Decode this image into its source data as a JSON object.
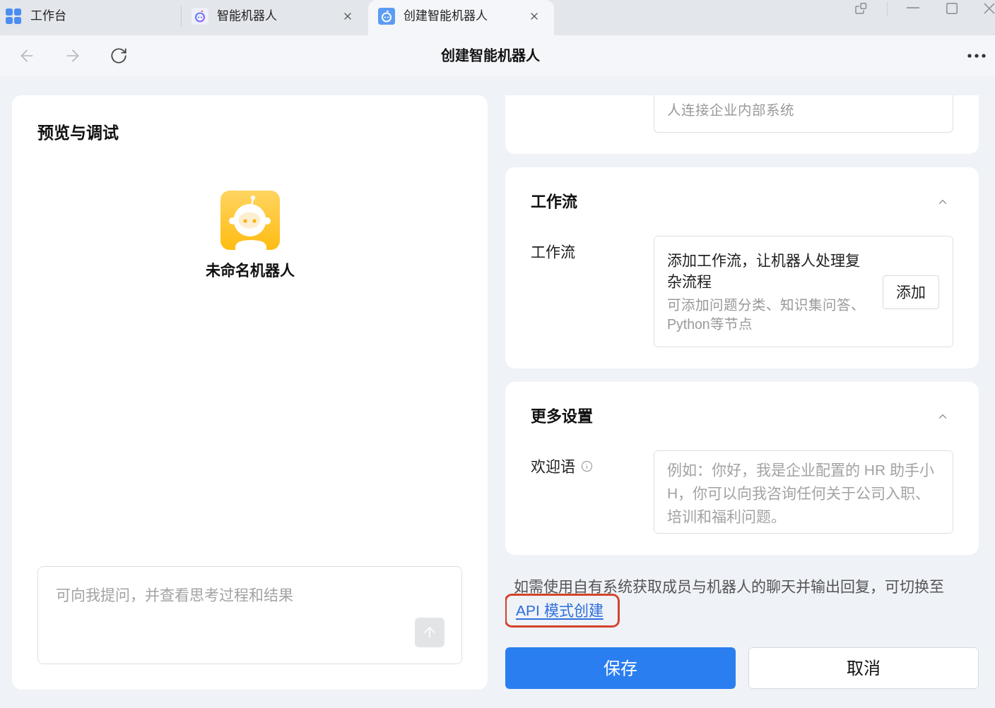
{
  "tabs": [
    {
      "label": "工作台",
      "kind": "home",
      "selected": false,
      "closable": false
    },
    {
      "label": "智能机器人",
      "kind": "bot",
      "selected": false,
      "closable": true
    },
    {
      "label": "创建智能机器人",
      "kind": "bot-editor",
      "selected": true,
      "closable": true
    }
  ],
  "nav": {
    "buttons": [
      {
        "kind": "back",
        "disabled": true
      },
      {
        "kind": "forward",
        "disabled": true
      },
      {
        "kind": "refresh",
        "disabled": false
      }
    ],
    "title": "创建智能机器人"
  },
  "preview": {
    "title": "预览与调试",
    "bot_name": "未命名机器人",
    "chat_input": {
      "placeholder": "可向我提问，并查看思考过程和结果"
    },
    "send_disabled": true
  },
  "plugin_card": {
    "description": "人连接企业内部系统"
  },
  "sections": [
    {
      "kind": "workflow",
      "title": "工作流",
      "expanded": true,
      "label": "工作流",
      "headline": "添加工作流，让机器人处理复杂流程",
      "description": "可添加问题分类、知识集问答、Python等节点",
      "button": "添加"
    },
    {
      "kind": "welcome",
      "title": "更多设置",
      "expanded": true,
      "label": "欢迎语",
      "placeholder": "例如：你好，我是企业配置的 HR 助手小H，你可以向我咨询任何关于公司入职、培训和福利问题。"
    }
  ],
  "api_note": {
    "text": "如需使用自有系统获取成员与机器人的聊天并输出回复，可切换至",
    "link": "API 模式创建",
    "highlighted": true
  },
  "actions": [
    {
      "label": "保存",
      "kind": "primary"
    },
    {
      "label": "取消",
      "kind": "secondary"
    }
  ]
}
